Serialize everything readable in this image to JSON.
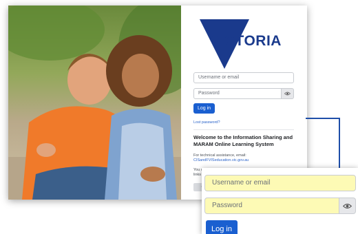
{
  "brand": {
    "logo_text": "VICTORIA",
    "color": "#1a3a8c"
  },
  "login": {
    "username_placeholder": "Username or email",
    "password_placeholder": "Password",
    "login_label": "Log in",
    "lost_password": "Lost password?"
  },
  "welcome": {
    "title": "Welcome to the Information Sharing and MARAM Online Learning System",
    "tech_text": "For technical assistance, email:",
    "email": "CISandFVISeducation.vic.gov.au",
    "terms_text": "You can review the Terms of Use and Privacy Notice at these links",
    "cookie_button": "Co"
  },
  "zoom": {
    "username_placeholder": "Username or email",
    "password_placeholder": "Password",
    "login_label": "Log in"
  },
  "icons": {
    "eye": "eye-icon",
    "logo": "victoria-logo-icon"
  },
  "colors": {
    "primary": "#1a5fd0",
    "highlight": "#fdfab5",
    "connector": "#1e4ea8"
  }
}
